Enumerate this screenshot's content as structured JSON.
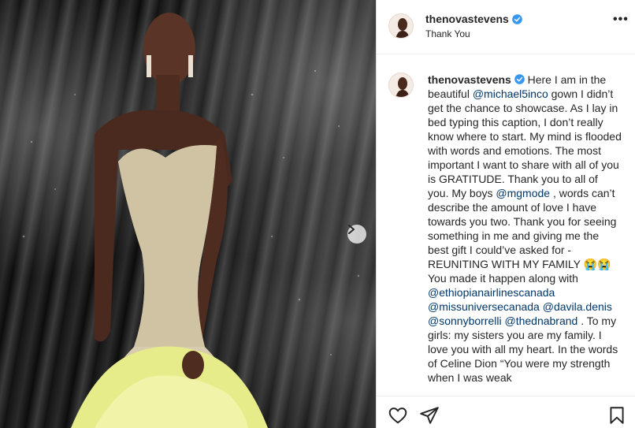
{
  "post": {
    "username": "thenovastevens",
    "location": "Thank You",
    "more_label": "•••",
    "caption_segments": [
      {
        "type": "text",
        "text": "Here I am in the beautiful "
      },
      {
        "type": "mention",
        "text": "@michael5inco"
      },
      {
        "type": "text",
        "text": " gown I didn’t get the chance to showcase. As I lay in bed typing this caption, I don’t really know where to start. My mind is flooded with words and emotions. The most important I want to share with all of you is GRATITUDE. Thank you to all of you. My boys "
      },
      {
        "type": "mention",
        "text": "@mgmode"
      },
      {
        "type": "text",
        "text": " , words can’t describe the amount of love I have towards you two. Thank you for seeing something in me and giving me the best gift I could’ve asked for - REUNITING WITH MY FAMILY 😭😭 You made it happen along with "
      },
      {
        "type": "mention",
        "text": "@ethiopianairlinescanada"
      },
      {
        "type": "text",
        "text": " "
      },
      {
        "type": "mention",
        "text": "@missuniversecanada"
      },
      {
        "type": "text",
        "text": " "
      },
      {
        "type": "mention",
        "text": "@davila.denis"
      },
      {
        "type": "text",
        "text": " "
      },
      {
        "type": "mention",
        "text": "@sonnyborrelli"
      },
      {
        "type": "text",
        "text": " "
      },
      {
        "type": "mention",
        "text": "@thednabrand"
      },
      {
        "type": "text",
        "text": " . To my girls: my sisters you are my family. I love you with all my heart. In the words of Celine Dion “You were my strength when I was weak"
      }
    ]
  },
  "icons": {
    "verified": "verified-badge-icon",
    "next": "chevron-right-icon",
    "like": "heart-icon",
    "share": "paper-plane-icon",
    "save": "bookmark-icon"
  },
  "colors": {
    "mention": "#00376b",
    "verified": "#3897f0",
    "text": "#262626",
    "divider": "#dbdbdb"
  }
}
